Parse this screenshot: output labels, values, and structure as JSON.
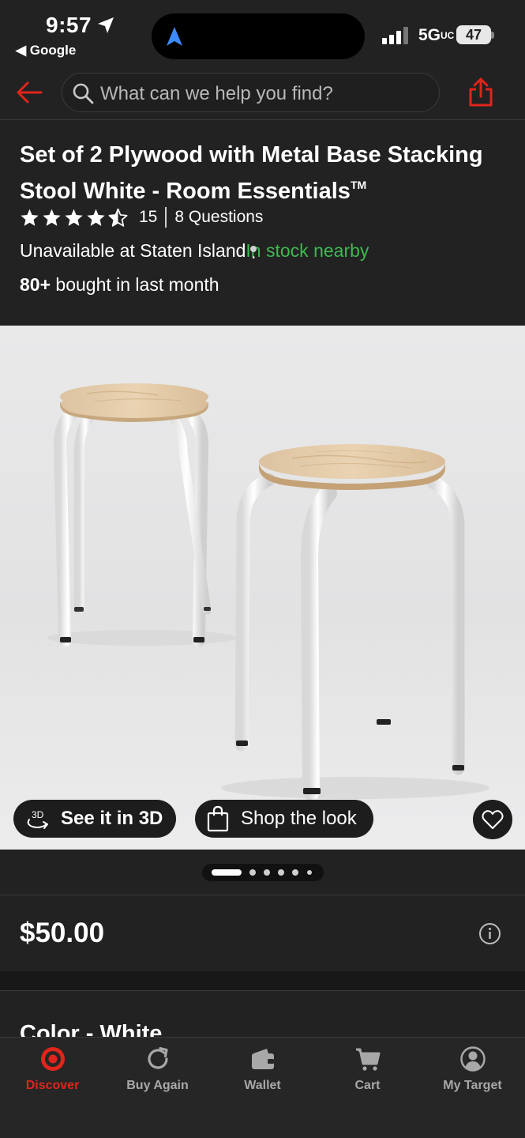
{
  "status_bar": {
    "time": "9:57",
    "back_app": "◀ Google",
    "network": "5G",
    "network_suffix": "UC",
    "battery": "47"
  },
  "header": {
    "search_placeholder": "What can we help you find?"
  },
  "product": {
    "title": "Set of 2  Plywood with Metal Base Stacking Stool White - Room Essentials",
    "title_mark": "TM",
    "rating_value": 4.5,
    "rating_count": "15",
    "questions": "8 Questions",
    "availability": "Unavailable at Staten Island",
    "availability_separator": "·",
    "nearby": "In stock nearby",
    "bought_count": "80+",
    "bought_text": " bought in last month",
    "price": "$50.00",
    "color_label": "Color - White"
  },
  "media": {
    "see_3d_label": "See it in 3D",
    "shop_look_label": "Shop the look",
    "carousel_total": 6,
    "carousel_active": 0
  },
  "tabs": [
    {
      "label": "Discover",
      "icon": "target-bullseye-icon",
      "active": true
    },
    {
      "label": "Buy Again",
      "icon": "refresh-icon",
      "active": false
    },
    {
      "label": "Wallet",
      "icon": "wallet-icon",
      "active": false
    },
    {
      "label": "Cart",
      "icon": "cart-icon",
      "active": false
    },
    {
      "label": "My Target",
      "icon": "account-icon",
      "active": false
    }
  ],
  "colors": {
    "accent_red": "#e0251b",
    "in_stock_green": "#3fb950",
    "background": "#222222"
  }
}
